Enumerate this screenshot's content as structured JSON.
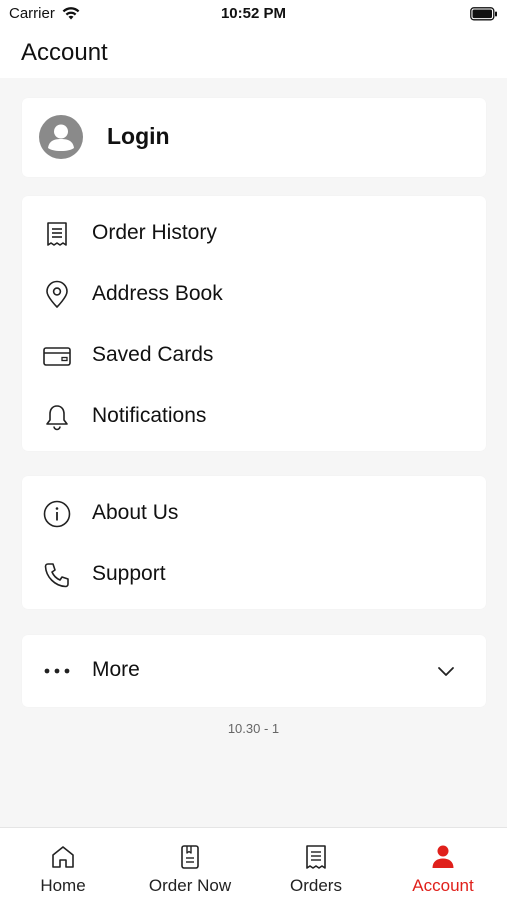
{
  "status_bar": {
    "carrier": "Carrier",
    "time": "10:52 PM"
  },
  "header": {
    "title": "Account"
  },
  "login": {
    "label": "Login",
    "icon": "avatar-icon"
  },
  "menu_primary": [
    {
      "label": "Order History",
      "icon": "receipt-icon"
    },
    {
      "label": "Address Book",
      "icon": "location-pin-icon"
    },
    {
      "label": "Saved Cards",
      "icon": "credit-card-icon"
    },
    {
      "label": "Notifications",
      "icon": "bell-icon"
    }
  ],
  "menu_secondary": [
    {
      "label": "About Us",
      "icon": "info-icon"
    },
    {
      "label": "Support",
      "icon": "phone-icon"
    }
  ],
  "more": {
    "label": "More",
    "icon": "ellipsis-icon",
    "expanded": false
  },
  "version": "10.30 - 1",
  "tabs": [
    {
      "label": "Home",
      "icon": "home-icon",
      "active": false
    },
    {
      "label": "Order Now",
      "icon": "menu-book-icon",
      "active": false
    },
    {
      "label": "Orders",
      "icon": "orders-receipt-icon",
      "active": false
    },
    {
      "label": "Account",
      "icon": "person-icon",
      "active": true
    }
  ],
  "colors": {
    "accent": "#e0201b",
    "background": "#f6f6f6",
    "card": "#ffffff",
    "avatar": "#8a8a8a"
  }
}
